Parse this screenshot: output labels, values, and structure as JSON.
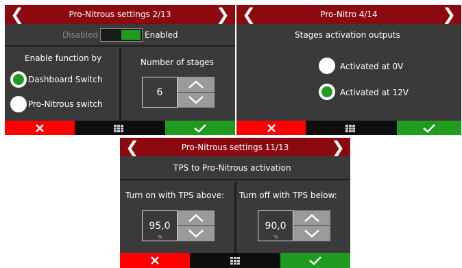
{
  "screen1": {
    "title": "Pro-Nitrous settings 2/13",
    "toggle": {
      "off_label": "Disabled",
      "on_label": "Enabled",
      "state": "enabled"
    },
    "enable_by": {
      "heading": "Enable function by",
      "options": [
        {
          "label": "Dashboard Switch",
          "checked": true
        },
        {
          "label": "Pro-Nitrous switch",
          "checked": false
        }
      ]
    },
    "stages": {
      "heading": "Number of stages",
      "value": "6"
    }
  },
  "screen2": {
    "title": "Pro-Nitro 4/14",
    "heading": "Stages activation outputs",
    "options": [
      {
        "label": "Activated at 0V",
        "checked": false
      },
      {
        "label": "Activated at 12V",
        "checked": true
      }
    ]
  },
  "screen3": {
    "title": "Pro-Nitrous settings 11/13",
    "heading": "TPS to Pro-Nitrous activation",
    "turn_on": {
      "label": "Turn on with TPS above:",
      "value": "95,0",
      "unit": "%"
    },
    "turn_off": {
      "label": "Turn off with TPS below:",
      "value": "90,0",
      "unit": "%"
    }
  },
  "colors": {
    "titlebar": "#8b0a10",
    "panel": "#3a3a3a",
    "cancel": "#ff0000",
    "confirm": "#1f9c1f"
  },
  "icons": {
    "prev": "chevron-left-icon",
    "next": "chevron-right-icon",
    "cancel": "close-icon",
    "menu": "grid-menu-icon",
    "confirm": "check-icon",
    "up": "chevron-up-icon",
    "down": "chevron-down-icon"
  }
}
